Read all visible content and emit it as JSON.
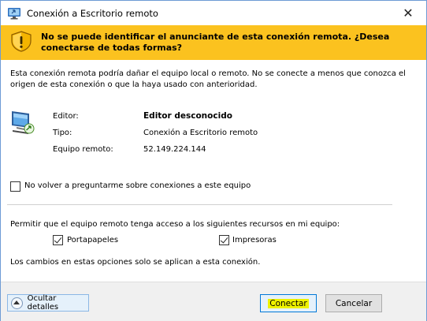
{
  "window": {
    "title": "Conexión a Escritorio remoto",
    "close_glyph": "✕"
  },
  "warning": {
    "icon": "warning-shield-icon",
    "text": "No se puede identificar el anunciante de esta conexión remota. ¿Desea conectarse de todas formas?"
  },
  "intro": "Esta conexión remota podría dañar el equipo local o remoto. No se conecte a menos que conozca el origen de esta conexión o que la haya usado con anterioridad.",
  "details": {
    "icon": "remote-computer-icon",
    "rows": [
      {
        "label": "Editor:",
        "value": "Editor desconocido"
      },
      {
        "label": "Tipo:",
        "value": "Conexión a Escritorio remoto"
      },
      {
        "label": "Equipo remoto:",
        "value": "52.149.224.144"
      }
    ]
  },
  "dont_ask": {
    "label": "No volver a preguntarme sobre conexiones a este equipo",
    "checked": false
  },
  "resources": {
    "heading": "Permitir que el equipo remoto tenga acceso a los siguientes recursos en mi equipo:",
    "items": [
      {
        "label": "Portapapeles",
        "checked": true
      },
      {
        "label": "Impresoras",
        "checked": true
      }
    ],
    "note": "Los cambios en estas opciones solo se aplican a esta conexión."
  },
  "buttons": {
    "details_label": "Ocultar detalles",
    "connect_label": "Conectar",
    "cancel_label": "Cancelar"
  },
  "colors": {
    "banner": "#fbc21f",
    "highlight": "#eef200",
    "accent": "#0078d7"
  }
}
